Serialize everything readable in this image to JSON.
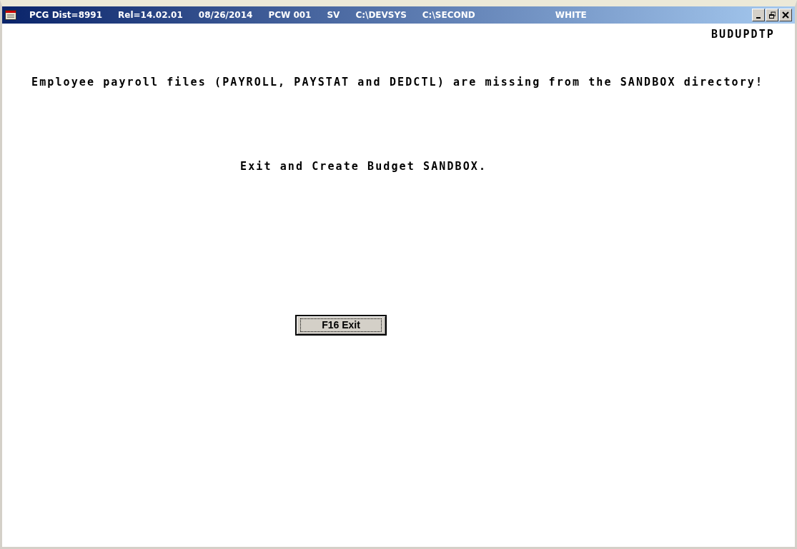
{
  "window": {
    "title_parts": [
      "PCG Dist=8991",
      "Rel=14.02.01",
      "08/26/2014",
      "PCW 001",
      "SV",
      "C:\\DEVSYS",
      "C:\\SECOND"
    ],
    "title_tag": "WHITE"
  },
  "program_id": "BUDUPDTP",
  "messages": [
    "Employee payroll files (PAYROLL, PAYSTAT and DEDCTL) are missing from the SANDBOX directory!",
    "Exit and Create Budget SANDBOX."
  ],
  "buttons": [
    {
      "label": "F16 Exit",
      "focused": true
    }
  ]
}
